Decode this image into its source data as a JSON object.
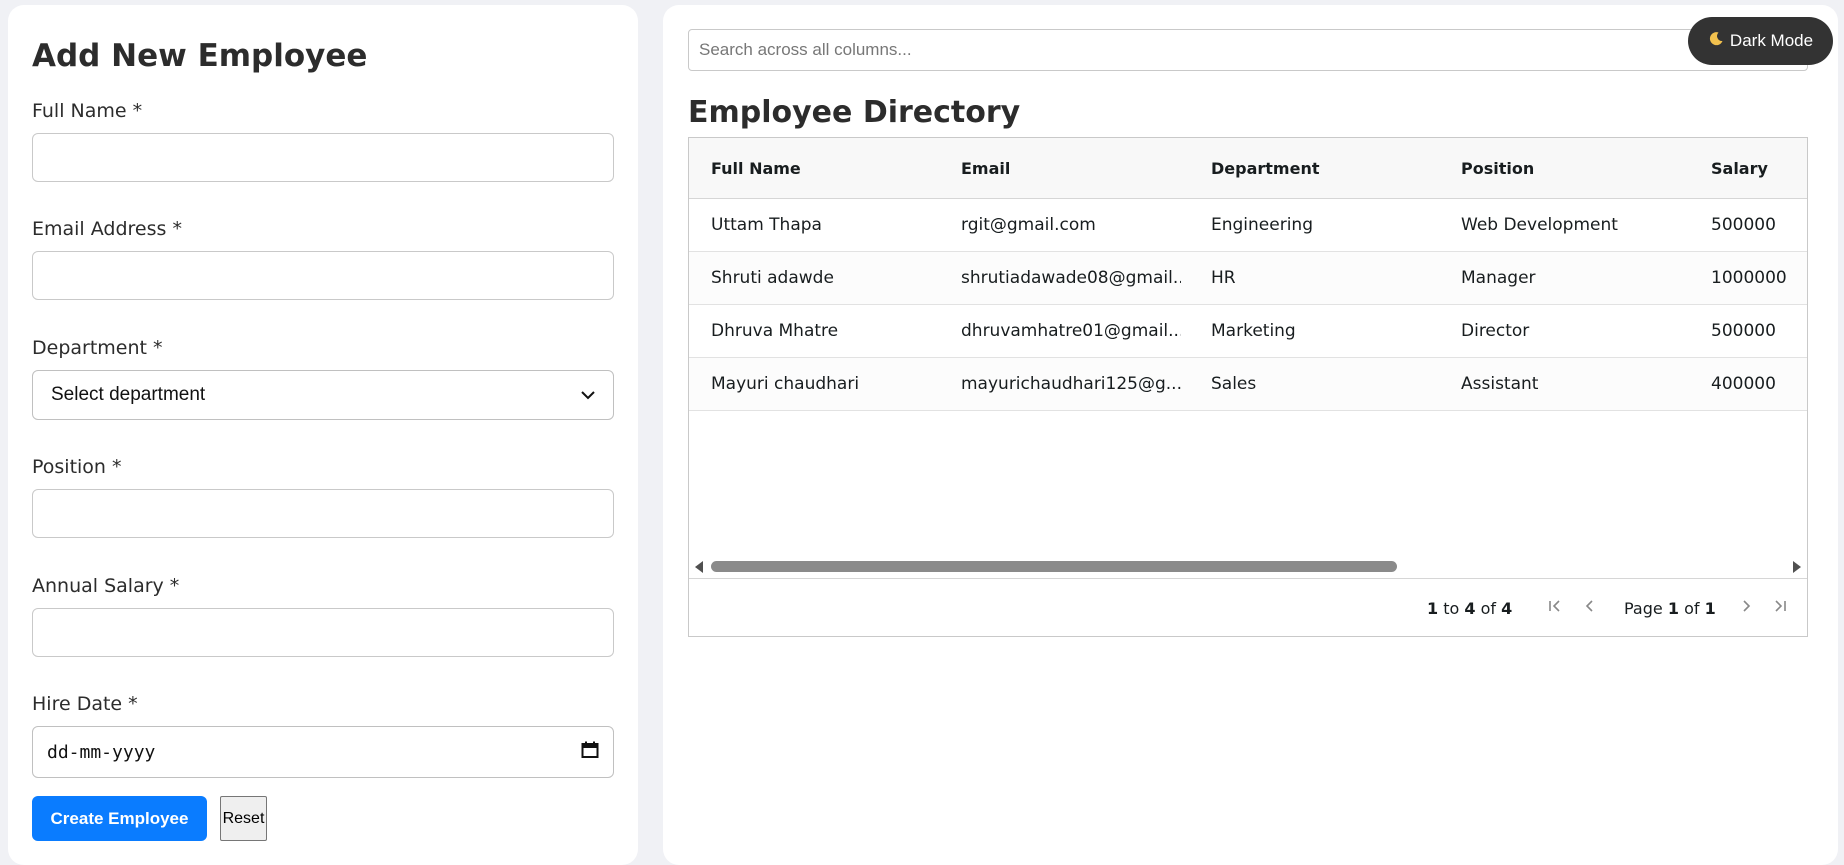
{
  "form": {
    "title": "Add New Employee",
    "full_name_label": "Full Name *",
    "full_name_value": "",
    "email_label": "Email Address *",
    "email_value": "",
    "department_label": "Department *",
    "department_selected": "Select department",
    "position_label": "Position *",
    "position_value": "",
    "salary_label": "Annual Salary *",
    "salary_value": "",
    "hire_date_label": "Hire Date *",
    "hire_date_placeholder": "dd-mm-yyyy",
    "create_label": "Create Employee",
    "reset_label": "Reset"
  },
  "search": {
    "placeholder": "Search across all columns..."
  },
  "theme_toggle": {
    "label": "Dark Mode",
    "icon": "moon-icon"
  },
  "directory": {
    "title": "Employee Directory",
    "columns": [
      "Full Name",
      "Email",
      "Department",
      "Position",
      "Salary"
    ],
    "rows": [
      [
        "Uttam Thapa",
        "rgit@gmail.com",
        "Engineering",
        "Web Development",
        "500000"
      ],
      [
        "Shruti adawde",
        "shrutiadawade08@gmail...",
        "HR",
        "Manager",
        "1000000"
      ],
      [
        "Dhruva Mhatre",
        "dhruvamhatre01@gmail....",
        "Marketing",
        "Director",
        "500000"
      ],
      [
        "Mayuri chaudhari",
        "mayurichaudhari125@g...",
        "Sales",
        "Assistant",
        "400000"
      ]
    ],
    "pagination": {
      "from": "1",
      "to_word": "to",
      "to": "4",
      "of_word": "of",
      "total": "4",
      "page_word": "Page",
      "page": "1",
      "page_of_word": "of",
      "page_total": "1"
    }
  },
  "colors": {
    "primary": "#0a7cff",
    "toggle_bg": "#333333",
    "page_bg": "#f0f1f5"
  }
}
